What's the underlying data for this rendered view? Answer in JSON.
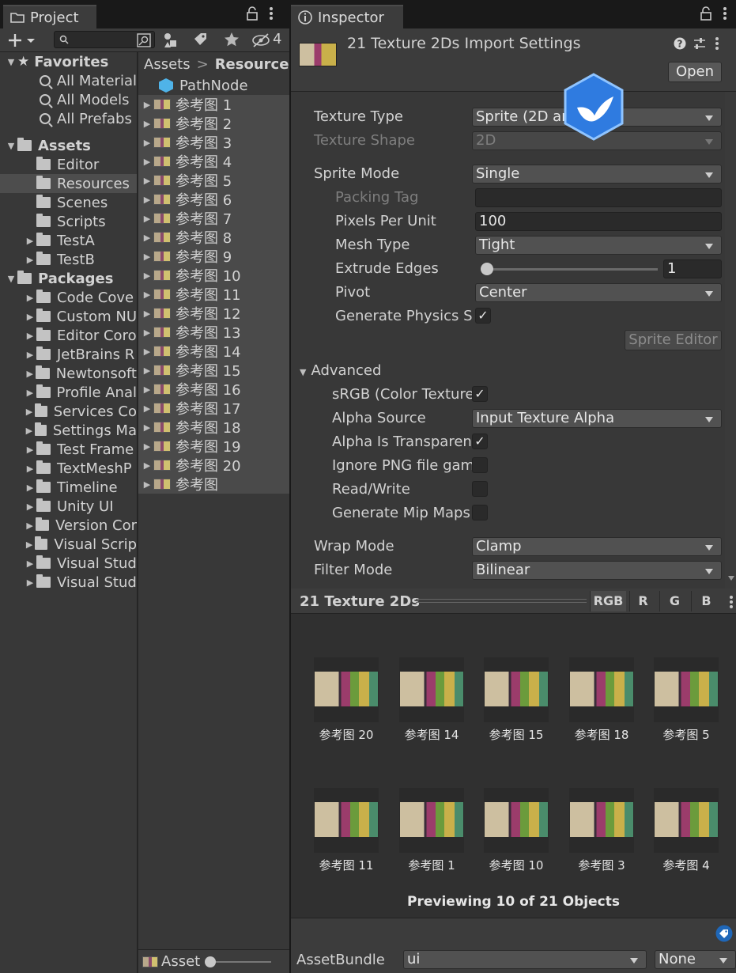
{
  "project": {
    "tab_title": "Project",
    "lock_icon": "lock-icon",
    "hidden_count": "4",
    "favorites": {
      "label": "Favorites",
      "items": [
        "All Material",
        "All Models",
        "All Prefabs"
      ]
    },
    "assets": {
      "label": "Assets",
      "items": [
        {
          "label": "Editor",
          "has_arrow": false,
          "selected": false
        },
        {
          "label": "Resources",
          "has_arrow": false,
          "selected": true
        },
        {
          "label": "Scenes",
          "has_arrow": false,
          "selected": false
        },
        {
          "label": "Scripts",
          "has_arrow": false,
          "selected": false
        },
        {
          "label": "TestA",
          "has_arrow": true,
          "selected": false
        },
        {
          "label": "TestB",
          "has_arrow": true,
          "selected": false
        }
      ]
    },
    "packages": {
      "label": "Packages",
      "items": [
        "Code Cove",
        "Custom NU",
        "Editor Coro",
        "JetBrains R",
        "Newtonsoft",
        "Profile Anal",
        "Services Co",
        "Settings Ma",
        "Test Frame",
        "TextMeshP",
        "Timeline",
        "Unity UI",
        "Version Cor",
        "Visual Scrip",
        "Visual Stud",
        "Visual Stud"
      ]
    },
    "breadcrumb": {
      "root": "Assets",
      "separator": ">",
      "current": "Resources"
    },
    "files": {
      "first": "PathNode",
      "textures": [
        "参考图 1",
        "参考图 2",
        "参考图 3",
        "参考图 4",
        "参考图 5",
        "参考图 6",
        "参考图 7",
        "参考图 8",
        "参考图 9",
        "参考图 10",
        "参考图 11",
        "参考图 12",
        "参考图 13",
        "参考图 14",
        "参考图 15",
        "参考图 16",
        "参考图 17",
        "参考图 18",
        "参考图 19",
        "参考图 20",
        "参考图"
      ]
    },
    "bottom_label": "Asset"
  },
  "inspector": {
    "tab_title": "Inspector",
    "header_title": "21 Texture 2Ds Import Settings",
    "open_button": "Open",
    "texture_type": {
      "label": "Texture Type",
      "value": "Sprite (2D an"
    },
    "texture_shape": {
      "label": "Texture Shape",
      "value": "2D"
    },
    "sprite_mode": {
      "label": "Sprite Mode",
      "value": "Single"
    },
    "packing_tag": {
      "label": "Packing Tag",
      "value": ""
    },
    "pixels_per_unit": {
      "label": "Pixels Per Unit",
      "value": "100"
    },
    "mesh_type": {
      "label": "Mesh Type",
      "value": "Tight"
    },
    "extrude_edges": {
      "label": "Extrude Edges",
      "value": "1",
      "slider_fraction": 0.0
    },
    "pivot": {
      "label": "Pivot",
      "value": "Center"
    },
    "generate_physics": {
      "label": "Generate Physics S",
      "checked": true
    },
    "sprite_editor_button": "Sprite Editor",
    "advanced": {
      "label": "Advanced"
    },
    "srgb": {
      "label": "sRGB (Color Texture",
      "checked": true
    },
    "alpha_source": {
      "label": "Alpha Source",
      "value": "Input Texture Alpha"
    },
    "alpha_transparency": {
      "label": "Alpha Is Transparen",
      "checked": true
    },
    "ignore_png": {
      "label": "Ignore PNG file gam",
      "checked": false
    },
    "read_write": {
      "label": "Read/Write",
      "checked": false
    },
    "mip_maps": {
      "label": "Generate Mip Maps",
      "checked": false
    },
    "wrap_mode": {
      "label": "Wrap Mode",
      "value": "Clamp"
    },
    "filter_mode": {
      "label": "Filter Mode",
      "value": "Bilinear"
    },
    "preview": {
      "title": "21 Texture 2Ds",
      "channels": [
        "RGB",
        "R",
        "G",
        "B"
      ],
      "row1": [
        "参考图 20",
        "参考图 14",
        "参考图 15",
        "参考图 18",
        "参考图 5"
      ],
      "row2": [
        "参考图 11",
        "参考图 1",
        "参考图 10",
        "参考图 3",
        "参考图 4"
      ],
      "footer": "Previewing 10 of 21 Objects"
    },
    "asset_bundle": {
      "label": "AssetBundle",
      "value": "ui",
      "variant": "None"
    }
  }
}
